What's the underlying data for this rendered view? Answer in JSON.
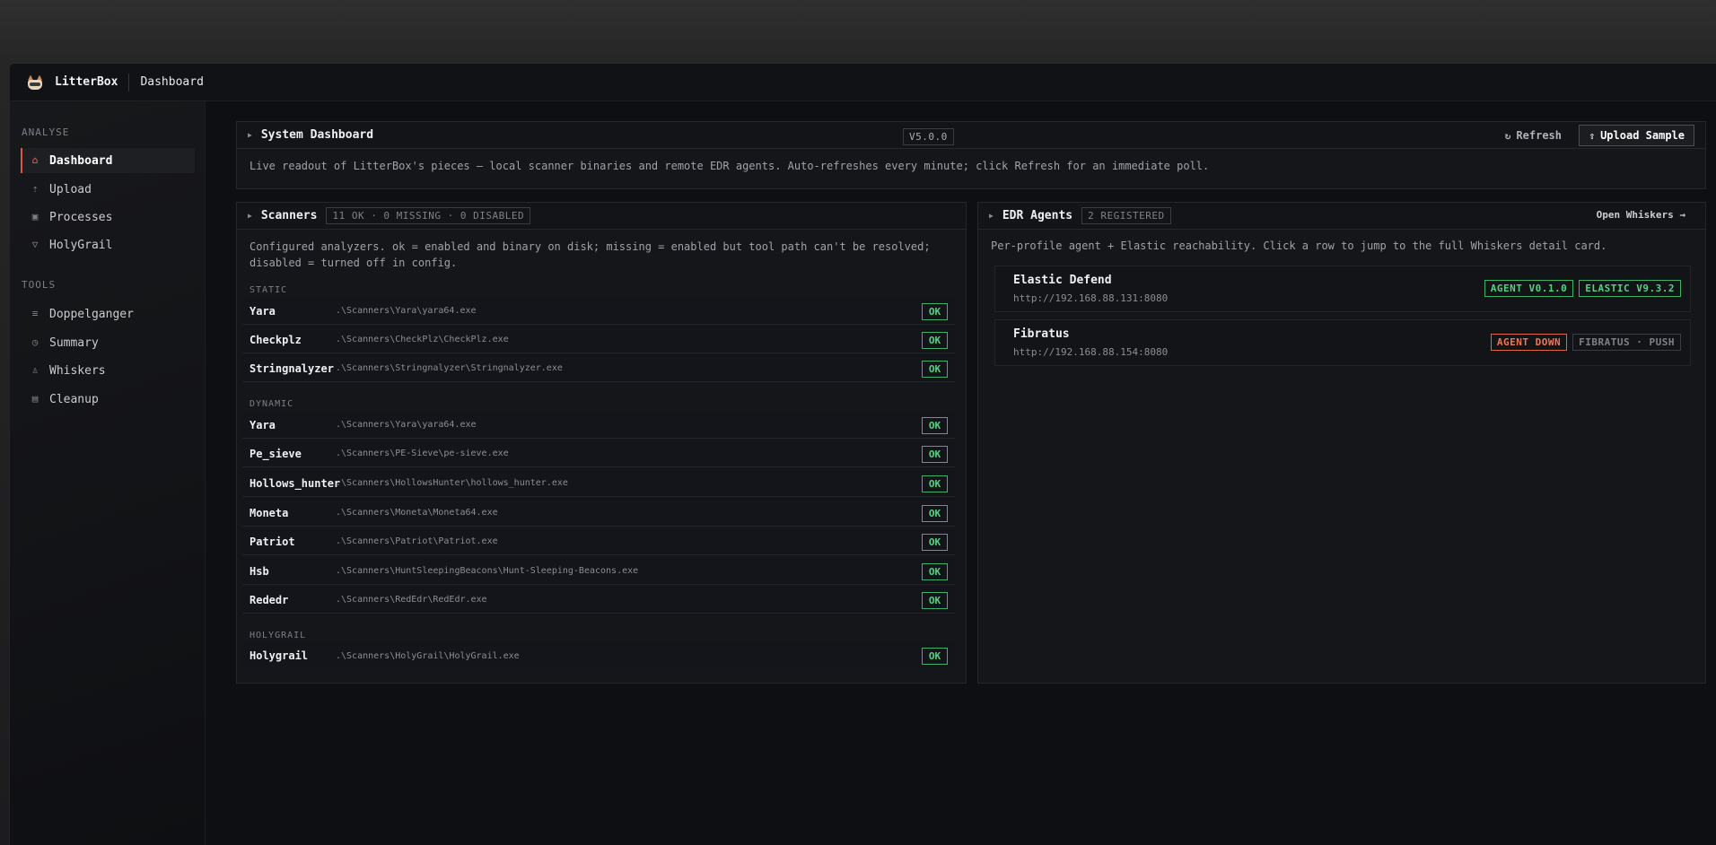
{
  "app": {
    "name": "LitterBox",
    "breadcrumb": "Dashboard"
  },
  "sidebar": {
    "sections": [
      {
        "label": "ANALYSE",
        "items": [
          {
            "label": "Dashboard",
            "icon": "home-icon",
            "active": true
          },
          {
            "label": "Upload",
            "icon": "upload-icon"
          },
          {
            "label": "Processes",
            "icon": "cpu-icon"
          },
          {
            "label": "HolyGrail",
            "icon": "chalice-icon"
          }
        ]
      },
      {
        "label": "TOOLS",
        "items": [
          {
            "label": "Doppelganger",
            "icon": "list-icon"
          },
          {
            "label": "Summary",
            "icon": "clock-icon"
          },
          {
            "label": "Whiskers",
            "icon": "agent-icon"
          },
          {
            "label": "Cleanup",
            "icon": "trash-icon"
          }
        ]
      }
    ]
  },
  "system": {
    "title": "System Dashboard",
    "version": "V5.0.0",
    "refresh_label": "Refresh",
    "upload_label": "Upload Sample",
    "description": "Live readout of LitterBox's pieces — local scanner binaries and remote EDR agents. Auto-refreshes every minute; click Refresh for an immediate poll."
  },
  "scanners": {
    "title": "Scanners",
    "summary": "11 OK · 0 MISSING · 0 DISABLED",
    "desc_line1": "Configured analyzers. ok = enabled and binary on disk; missing = enabled but tool path can't be resolved;",
    "desc_line2": "disabled = turned off in config.",
    "groups": [
      {
        "label": "STATIC",
        "rows": [
          {
            "name": "Yara",
            "path": ".\\Scanners\\Yara\\yara64.exe",
            "status": "OK"
          },
          {
            "name": "Checkplz",
            "path": ".\\Scanners\\CheckPlz\\CheckPlz.exe",
            "status": "OK"
          },
          {
            "name": "Stringnalyzer",
            "path": ".\\Scanners\\Stringnalyzer\\Stringnalyzer.exe",
            "status": "OK"
          }
        ]
      },
      {
        "label": "DYNAMIC",
        "rows": [
          {
            "name": "Yara",
            "path": ".\\Scanners\\Yara\\yara64.exe",
            "status": "OK"
          },
          {
            "name": "Pe_sieve",
            "path": ".\\Scanners\\PE-Sieve\\pe-sieve.exe",
            "status": "OK"
          },
          {
            "name": "Hollows_hunter",
            "path": ".\\Scanners\\HollowsHunter\\hollows_hunter.exe",
            "status": "OK"
          },
          {
            "name": "Moneta",
            "path": ".\\Scanners\\Moneta\\Moneta64.exe",
            "status": "OK"
          },
          {
            "name": "Patriot",
            "path": ".\\Scanners\\Patriot\\Patriot.exe",
            "status": "OK"
          },
          {
            "name": "Hsb",
            "path": ".\\Scanners\\HuntSleepingBeacons\\Hunt-Sleeping-Beacons.exe",
            "status": "OK"
          },
          {
            "name": "Rededr",
            "path": ".\\Scanners\\RedEdr\\RedEdr.exe",
            "status": "OK"
          }
        ]
      },
      {
        "label": "HOLYGRAIL",
        "rows": [
          {
            "name": "Holygrail",
            "path": ".\\Scanners\\HolyGrail\\HolyGrail.exe",
            "status": "OK"
          }
        ]
      }
    ]
  },
  "edr": {
    "title": "EDR Agents",
    "count": "2 REGISTERED",
    "open_label": "Open Whiskers →",
    "description": "Per-profile agent + Elastic reachability. Click a row to jump to the full Whiskers detail card.",
    "agents": [
      {
        "name": "Elastic Defend",
        "url": "http://192.168.88.131:8080",
        "badges": [
          {
            "text": "AGENT V0.1.0",
            "tone": "green"
          },
          {
            "text": "ELASTIC V9.3.2",
            "tone": "green"
          }
        ]
      },
      {
        "name": "Fibratus",
        "url": "http://192.168.88.154:8080",
        "badges": [
          {
            "text": "AGENT DOWN",
            "tone": "red"
          },
          {
            "text": "FIBRATUS · PUSH",
            "tone": "gray"
          }
        ]
      }
    ]
  },
  "colors": {
    "accent": "#d9574a",
    "ok": "#52d384",
    "danger": "#ef7654"
  }
}
